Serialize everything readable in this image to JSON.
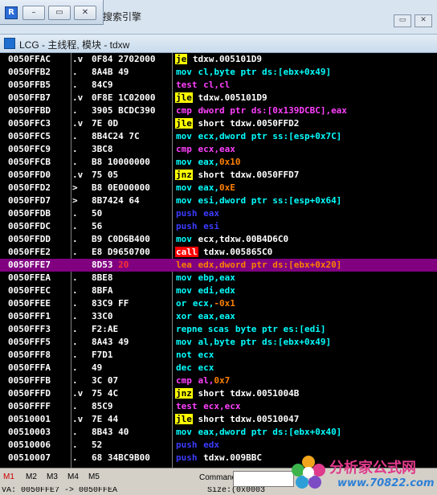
{
  "background_app": {
    "title": "搜索引擎",
    "mini_icon": "R",
    "buttons": [
      "minimize-icon",
      "restore-icon",
      "close-icon"
    ]
  },
  "child_window": {
    "title": "LCG - 主线程, 模块 - tdxw"
  },
  "listing": {
    "rows": [
      {
        "addr": "0050FFAC",
        "mark": ".v",
        "hex": "0F84 2702000",
        "mn": "je",
        "mnStyle": "yellow",
        "ops": [
          {
            "t": "tdxw.005101D9",
            "c": "white"
          }
        ]
      },
      {
        "addr": "0050FFB2",
        "mark": ".",
        "hex": "8A4B 49",
        "mn": "mov",
        "mnStyle": "cyan",
        "ops": [
          {
            "t": "cl,byte ptr ds:[ebx+0x49]",
            "c": "cyan"
          }
        ]
      },
      {
        "addr": "0050FFB5",
        "mark": ".",
        "hex": "84C9",
        "mn": "test",
        "mnStyle": "magenta",
        "ops": [
          {
            "t": "cl,cl",
            "c": "magenta"
          }
        ]
      },
      {
        "addr": "0050FFB7",
        "mark": ".v",
        "hex": "0F8E 1C02000",
        "mn": "jle",
        "mnStyle": "yellow",
        "ops": [
          {
            "t": "tdxw.005101D9",
            "c": "white"
          }
        ]
      },
      {
        "addr": "0050FFBD",
        "mark": ".",
        "hex": "3905 BCDC390",
        "mn": "cmp",
        "mnStyle": "magenta",
        "ops": [
          {
            "t": "dword ptr ds:[0x139DCBC],eax",
            "c": "magenta"
          }
        ]
      },
      {
        "addr": "0050FFC3",
        "mark": ".v",
        "hex": "7E 0D",
        "mn": "jle",
        "mnStyle": "yellow",
        "ops": [
          {
            "t": "short tdxw.0050FFD2",
            "c": "white"
          }
        ]
      },
      {
        "addr": "0050FFC5",
        "mark": ".",
        "hex": "8B4C24 7C",
        "mn": "mov",
        "mnStyle": "cyan",
        "ops": [
          {
            "t": "ecx,dword ptr ss:[esp+0x7C]",
            "c": "cyan"
          }
        ]
      },
      {
        "addr": "0050FFC9",
        "mark": ".",
        "hex": "3BC8",
        "mn": "cmp",
        "mnStyle": "magenta",
        "ops": [
          {
            "t": "ecx,eax",
            "c": "magenta"
          }
        ]
      },
      {
        "addr": "0050FFCB",
        "mark": ".",
        "hex": "B8 10000000",
        "mn": "mov",
        "mnStyle": "cyan",
        "ops": [
          {
            "t": "eax,",
            "c": "cyan"
          },
          {
            "t": "0x10",
            "c": "orange"
          }
        ]
      },
      {
        "addr": "0050FFD0",
        "mark": ".v",
        "hex": "75 05",
        "mn": "jnz",
        "mnStyle": "yellow",
        "ops": [
          {
            "t": "short tdxw.0050FFD7",
            "c": "white"
          }
        ]
      },
      {
        "addr": "0050FFD2",
        "mark": ">",
        "hex": "B8 0E000000",
        "mn": "mov",
        "mnStyle": "cyan",
        "ops": [
          {
            "t": "eax,",
            "c": "cyan"
          },
          {
            "t": "0xE",
            "c": "orange"
          }
        ]
      },
      {
        "addr": "0050FFD7",
        "mark": ">",
        "hex": "8B7424 64",
        "mn": "mov",
        "mnStyle": "cyan",
        "ops": [
          {
            "t": "esi,dword ptr ss:[esp+0x64]",
            "c": "cyan"
          }
        ]
      },
      {
        "addr": "0050FFDB",
        "mark": ".",
        "hex": "50",
        "mn": "push",
        "mnStyle": "blue",
        "ops": [
          {
            "t": "eax",
            "c": "blue"
          }
        ]
      },
      {
        "addr": "0050FFDC",
        "mark": ".",
        "hex": "56",
        "mn": "push",
        "mnStyle": "blue",
        "ops": [
          {
            "t": "esi",
            "c": "blue"
          }
        ]
      },
      {
        "addr": "0050FFDD",
        "mark": ".",
        "hex": "B9 C0D6B400",
        "mn": "mov",
        "mnStyle": "cyan",
        "ops": [
          {
            "t": "ecx,tdxw.00B4D6C0",
            "c": "white"
          }
        ]
      },
      {
        "addr": "0050FFE2",
        "mark": ".",
        "hex": "E8 D9650700",
        "mn": "call",
        "mnStyle": "red",
        "ops": [
          {
            "t": "tdxw.005865C0",
            "c": "white"
          }
        ]
      },
      {
        "addr": "0050FFE7",
        "mark": "",
        "hex": "8D53 20",
        "hexHl": "20",
        "mn": "lea",
        "mnStyle": "cyan",
        "ops": [
          {
            "t": "edx,dword ptr ds:[ebx+0x20]",
            "c": "cyan"
          }
        ],
        "selected": true
      },
      {
        "addr": "0050FFEA",
        "mark": ".",
        "hex": "8BE8",
        "mn": "mov",
        "mnStyle": "cyan",
        "ops": [
          {
            "t": "ebp,eax",
            "c": "cyan"
          }
        ]
      },
      {
        "addr": "0050FFEC",
        "mark": ".",
        "hex": "8BFA",
        "mn": "mov",
        "mnStyle": "cyan",
        "ops": [
          {
            "t": "edi,edx",
            "c": "cyan"
          }
        ]
      },
      {
        "addr": "0050FFEE",
        "mark": ".",
        "hex": "83C9 FF",
        "mn": "or",
        "mnStyle": "cyan",
        "ops": [
          {
            "t": "ecx,",
            "c": "cyan"
          },
          {
            "t": "-0x1",
            "c": "orange"
          }
        ]
      },
      {
        "addr": "0050FFF1",
        "mark": ".",
        "hex": "33C0",
        "mn": "xor",
        "mnStyle": "cyan",
        "ops": [
          {
            "t": "eax,eax",
            "c": "cyan"
          }
        ]
      },
      {
        "addr": "0050FFF3",
        "mark": ".",
        "hex": "F2:AE",
        "mn": "repne scas",
        "mnStyle": "cyan",
        "ops": [
          {
            "t": "byte ptr es:[edi]",
            "c": "cyan"
          }
        ]
      },
      {
        "addr": "0050FFF5",
        "mark": ".",
        "hex": "8A43 49",
        "mn": "mov",
        "mnStyle": "cyan",
        "ops": [
          {
            "t": "al,byte ptr ds:[ebx+0x49]",
            "c": "cyan"
          }
        ]
      },
      {
        "addr": "0050FFF8",
        "mark": ".",
        "hex": "F7D1",
        "mn": "not",
        "mnStyle": "cyan",
        "ops": [
          {
            "t": "ecx",
            "c": "cyan"
          }
        ]
      },
      {
        "addr": "0050FFFA",
        "mark": ".",
        "hex": "49",
        "mn": "dec",
        "mnStyle": "cyan",
        "ops": [
          {
            "t": "ecx",
            "c": "cyan"
          }
        ]
      },
      {
        "addr": "0050FFFB",
        "mark": ".",
        "hex": "3C 07",
        "mn": "cmp",
        "mnStyle": "magenta",
        "ops": [
          {
            "t": "al,",
            "c": "magenta"
          },
          {
            "t": "0x7",
            "c": "orange"
          }
        ]
      },
      {
        "addr": "0050FFFD",
        "mark": ".v",
        "hex": "75 4C",
        "mn": "jnz",
        "mnStyle": "yellow",
        "ops": [
          {
            "t": "short tdxw.0051004B",
            "c": "white"
          }
        ]
      },
      {
        "addr": "0050FFFF",
        "mark": ".",
        "hex": "85C9",
        "mn": "test",
        "mnStyle": "magenta",
        "ops": [
          {
            "t": "ecx,ecx",
            "c": "magenta"
          }
        ]
      },
      {
        "addr": "00510001",
        "mark": ".v",
        "hex": "7E 44",
        "mn": "jle",
        "mnStyle": "yellow",
        "ops": [
          {
            "t": "short tdxw.00510047",
            "c": "white"
          }
        ]
      },
      {
        "addr": "00510003",
        "mark": ".",
        "hex": "8B43 40",
        "mn": "mov",
        "mnStyle": "cyan",
        "ops": [
          {
            "t": "eax,dword ptr ds:[ebx+0x40]",
            "c": "cyan"
          }
        ]
      },
      {
        "addr": "00510006",
        "mark": ".",
        "hex": "52",
        "mn": "push",
        "mnStyle": "blue",
        "ops": [
          {
            "t": "edx",
            "c": "blue"
          }
        ]
      },
      {
        "addr": "00510007",
        "mark": ".",
        "hex": "68 34BC9B00",
        "mn": "push",
        "mnStyle": "blue",
        "ops": [
          {
            "t": "tdxw.009BBC",
            "c": "white"
          }
        ]
      }
    ]
  },
  "bottombar": {
    "tabs": [
      "M1",
      "M2",
      "M3",
      "M4",
      "M5"
    ],
    "active_tab": "M1",
    "command_label": "Command:",
    "command_value": ""
  },
  "statusbar": {
    "left": "VA: 0050FFE7 -> 0050FFEA",
    "right": "Size:(0x0003"
  },
  "watermark": {
    "text": "分析家公式网",
    "url": "www.70822.com"
  },
  "colors": {
    "listing_bg": "#000000",
    "selection": "#800080",
    "jump_highlight": "#ffff00",
    "call_highlight": "#ff0000"
  }
}
